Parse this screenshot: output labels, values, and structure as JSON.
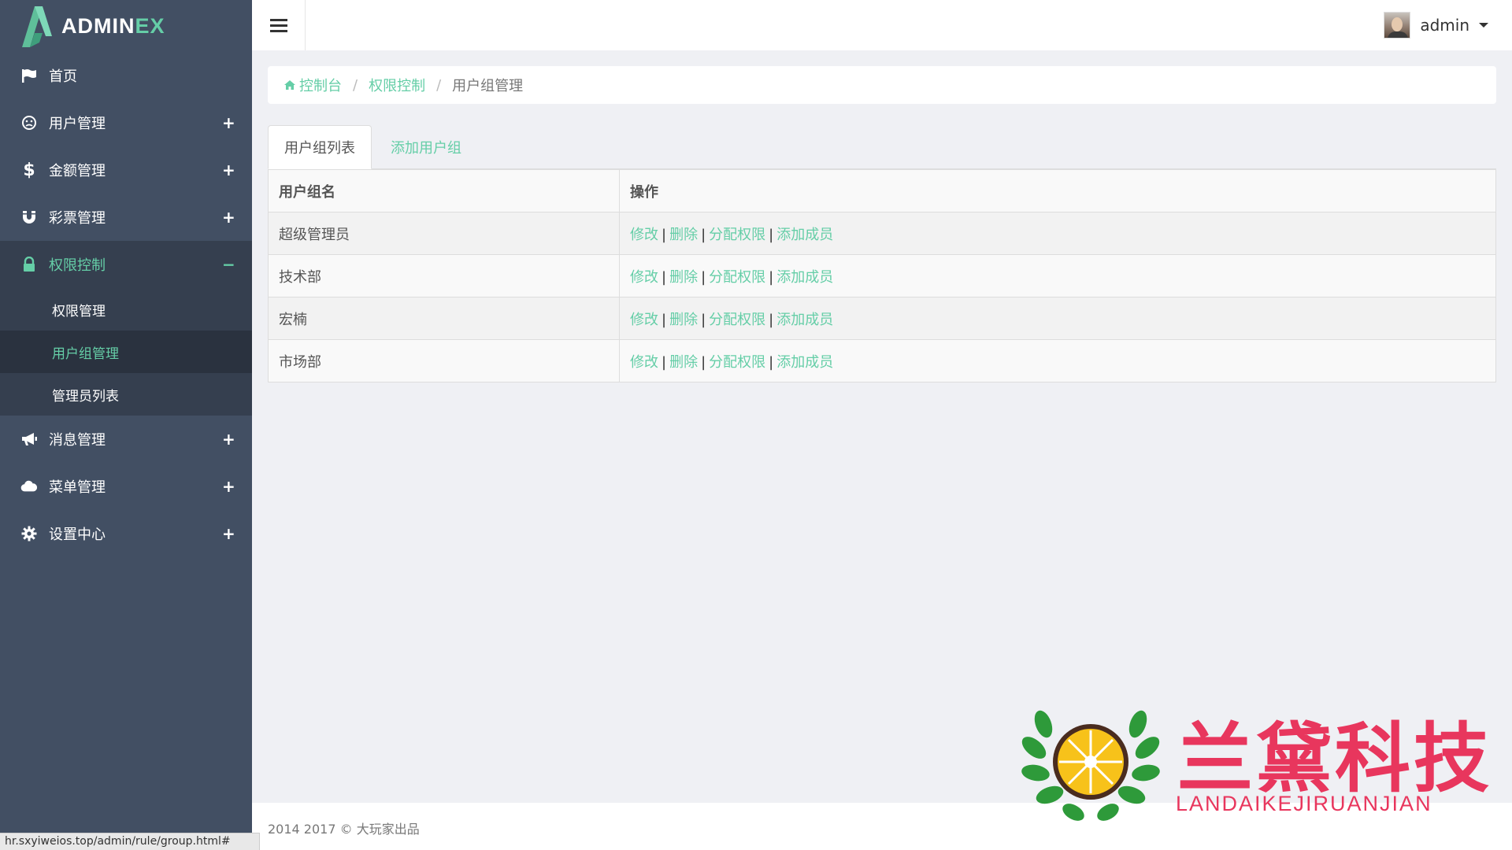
{
  "app": {
    "logo_main": "ADMIN",
    "logo_accent": "EX"
  },
  "sidebar": {
    "items": [
      {
        "label": "首页",
        "icon": "flag-icon",
        "toggle": ""
      },
      {
        "label": "用户管理",
        "icon": "smile-icon",
        "toggle": "+"
      },
      {
        "label": "金额管理",
        "icon": "dollar-icon",
        "toggle": "+"
      },
      {
        "label": "彩票管理",
        "icon": "magnet-icon",
        "toggle": "+"
      },
      {
        "label": "权限控制",
        "icon": "lock-icon",
        "toggle": "−"
      },
      {
        "label": "消息管理",
        "icon": "bullhorn-icon",
        "toggle": "+"
      },
      {
        "label": "菜单管理",
        "icon": "cloud-icon",
        "toggle": "+"
      },
      {
        "label": "设置中心",
        "icon": "gear-icon",
        "toggle": "+"
      }
    ],
    "subitems": [
      {
        "label": "权限管理"
      },
      {
        "label": "用户组管理"
      },
      {
        "label": "管理员列表"
      }
    ]
  },
  "header": {
    "username": "admin",
    "menu_icon": "hamburger-icon"
  },
  "breadcrumb": {
    "home": "控制台",
    "section": "权限控制",
    "current": "用户组管理",
    "separator": "/"
  },
  "tabs": {
    "list": "用户组列表",
    "add": "添加用户组"
  },
  "table": {
    "headers": [
      "用户组名",
      "操作"
    ],
    "rows": [
      {
        "name": "超级管理员"
      },
      {
        "name": "技术部"
      },
      {
        "name": "宏楠"
      },
      {
        "name": "市场部"
      }
    ],
    "actions": {
      "edit": "修改",
      "delete": "删除",
      "assign": "分配权限",
      "add_member": "添加成员",
      "sep": "|"
    }
  },
  "footer": {
    "text": "2014 2017 © 大玩家出品"
  },
  "statusbar": {
    "url": "hr.sxyiweios.top/admin/rule/group.html#"
  },
  "watermark": {
    "title": "兰黛科技",
    "subtitle": "LANDAIKEJIRUANJIAN"
  },
  "colors": {
    "sidebar_bg": "#424f63",
    "accent": "#65cea7",
    "watermark": "#e8365d"
  }
}
